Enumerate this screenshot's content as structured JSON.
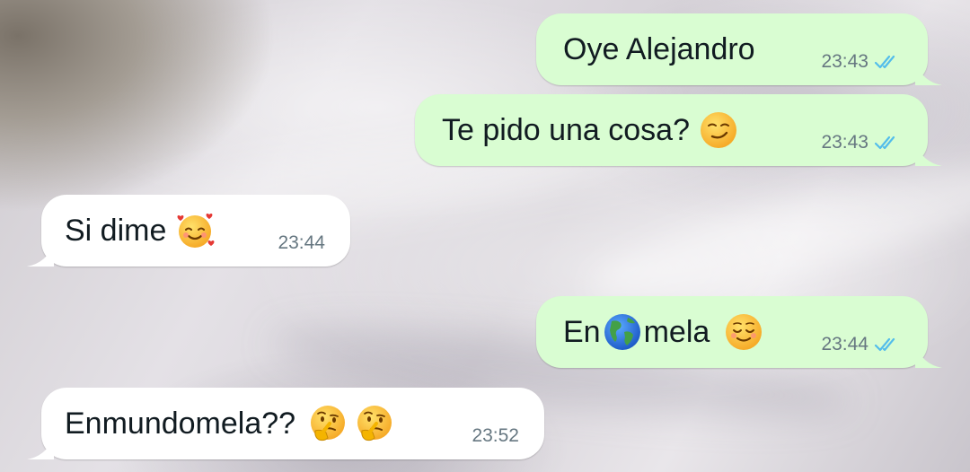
{
  "messages": [
    {
      "direction": "out",
      "text": "Oye Alejandro",
      "time": "23:43",
      "status": "read"
    },
    {
      "direction": "out",
      "text": "Te pido una cosa?",
      "emoji": [
        "smirking-face"
      ],
      "time": "23:43",
      "status": "read"
    },
    {
      "direction": "in",
      "text": "Si dime",
      "emoji": [
        "smiling-face-with-hearts"
      ],
      "time": "23:44"
    },
    {
      "direction": "out",
      "text_before": "En",
      "globe_emoji": "globe-americas",
      "text_after": "mela",
      "emoji": [
        "relieved-face"
      ],
      "time": "23:44",
      "status": "read"
    },
    {
      "direction": "in",
      "text": "Enmundomela??",
      "emoji": [
        "thinking-face",
        "thinking-face"
      ],
      "time": "23:52"
    }
  ],
  "colors": {
    "outgoing_bubble": "#d9fdd2",
    "incoming_bubble": "#ffffff",
    "read_ticks": "#53bdeb",
    "timestamp": "#667781"
  }
}
